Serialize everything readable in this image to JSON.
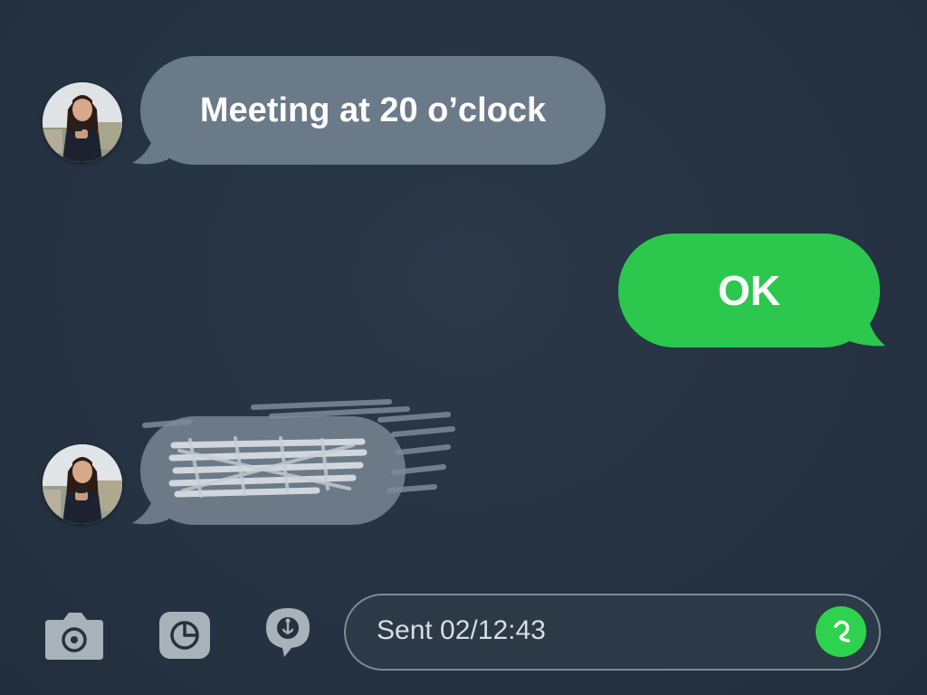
{
  "conversation": {
    "messages": [
      {
        "direction": "incoming",
        "text": "Meeting at 20 o’clock",
        "avatar": "contact-avatar"
      },
      {
        "direction": "outgoing",
        "text": "OK"
      },
      {
        "direction": "incoming",
        "text": "",
        "content": "redacted-scribble",
        "avatar": "contact-avatar"
      }
    ]
  },
  "composer": {
    "input_text": "Sent 02/12:43",
    "icons": {
      "camera": "camera-icon",
      "sticker": "sticker-icon",
      "voice": "voice-message-icon",
      "send": "send-icon"
    }
  },
  "colors": {
    "background": "#263343",
    "incoming_bubble": "#6b7a88",
    "outgoing_bubble": "#2cc84d",
    "send_button": "#2ed24e"
  }
}
